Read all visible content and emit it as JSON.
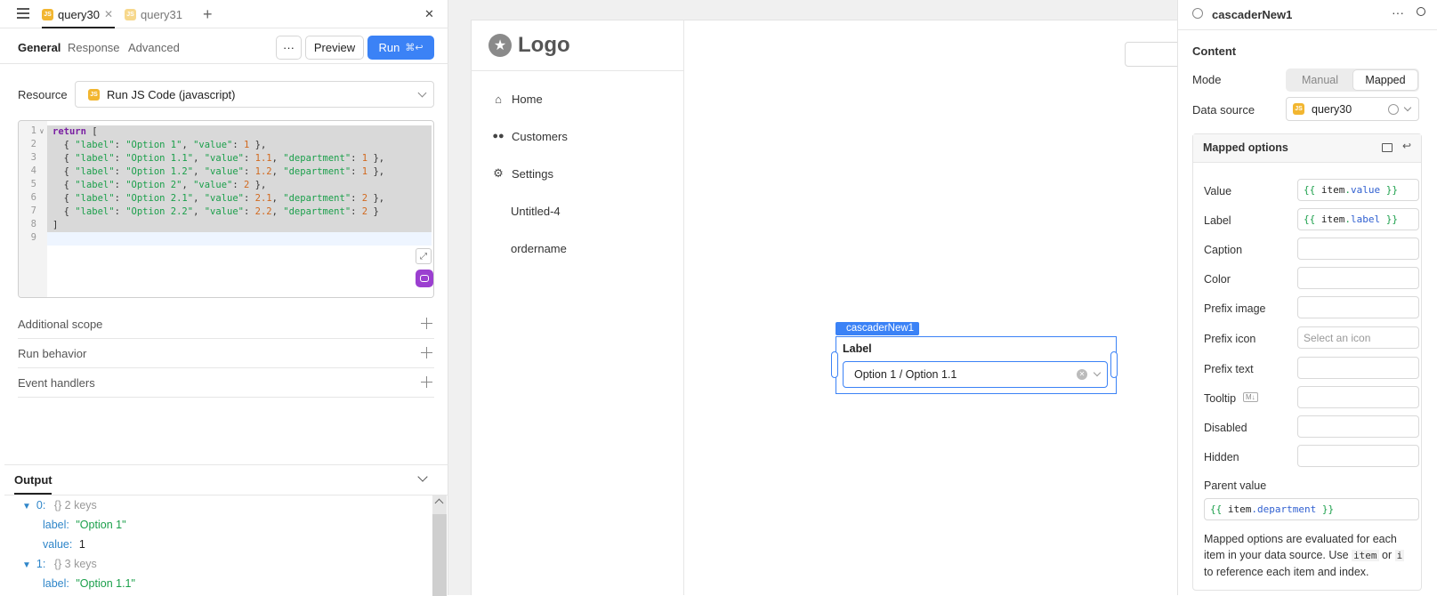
{
  "query_tabs": [
    {
      "label": "query30",
      "active": true
    },
    {
      "label": "query31",
      "active": false
    }
  ],
  "subtabs": [
    "General",
    "Response",
    "Advanced"
  ],
  "buttons": {
    "more": "···",
    "preview": "Preview",
    "run": "Run",
    "run_shortcut": "⌘↩"
  },
  "resource": {
    "label": "Resource",
    "value": "Run JS Code (javascript)"
  },
  "code_lines": [
    "return [",
    "  { \"label\": \"Option 1\", \"value\": 1 },",
    "  { \"label\": \"Option 1.1\", \"value\": 1.1, \"department\": 1 },",
    "  { \"label\": \"Option 1.2\", \"value\": 1.2, \"department\": 1 },",
    "  { \"label\": \"Option 2\", \"value\": 2 },",
    "  { \"label\": \"Option 2.1\", \"value\": 2.1, \"department\": 2 },",
    "  { \"label\": \"Option 2.2\", \"value\": 2.2, \"department\": 2 }",
    "]",
    ""
  ],
  "sections": [
    "Additional scope",
    "Run behavior",
    "Event handlers"
  ],
  "output": {
    "title": "Output",
    "rows": [
      {
        "type": "head",
        "index": "0:",
        "meta": "{}  2 keys"
      },
      {
        "type": "kv",
        "key": "label:",
        "value": "\"Option 1\"",
        "str": true
      },
      {
        "type": "kv",
        "key": "value:",
        "value": "1",
        "str": false
      },
      {
        "type": "head",
        "index": "1:",
        "meta": "{}  3 keys"
      },
      {
        "type": "kv",
        "key": "label:",
        "value": "\"Option 1.1\"",
        "str": true
      }
    ]
  },
  "app": {
    "logo": "Logo",
    "nav": [
      {
        "label": "Home",
        "icon": "home-icon"
      },
      {
        "label": "Customers",
        "icon": "users-icon"
      },
      {
        "label": "Settings",
        "icon": "gear-icon"
      },
      {
        "label": "Untitled-4",
        "icon": ""
      },
      {
        "label": "ordername",
        "icon": ""
      }
    ],
    "component_tag": "cascaderNew1",
    "field_label": "Label",
    "field_value": "Option 1 / Option 1.1"
  },
  "inspector": {
    "title": "cascaderNew1",
    "content_heading": "Content",
    "mode_label": "Mode",
    "mode_options": [
      "Manual",
      "Mapped"
    ],
    "mode_selected": "Mapped",
    "datasource_label": "Data source",
    "datasource_value": "query30",
    "mapped_heading": "Mapped options",
    "mapped_fields": [
      {
        "label": "Value",
        "value": "item.value"
      },
      {
        "label": "Label",
        "value": "item.label"
      },
      {
        "label": "Caption",
        "value": ""
      },
      {
        "label": "Color",
        "value": ""
      },
      {
        "label": "Prefix image",
        "value": ""
      },
      {
        "label": "Prefix icon",
        "placeholder": "Select an icon"
      },
      {
        "label": "Prefix text",
        "value": ""
      },
      {
        "label": "Tooltip",
        "value": "",
        "badge": "M↓"
      },
      {
        "label": "Disabled",
        "value": ""
      },
      {
        "label": "Hidden",
        "value": ""
      }
    ],
    "parent_value_label": "Parent value",
    "parent_value": "item.department",
    "help_text": [
      "Mapped options are evaluated for each",
      "item in your data source. Use",
      "or",
      "to reference each item and index."
    ],
    "help_code": [
      "item",
      "i"
    ]
  },
  "colors": {
    "accent": "#3b82f6",
    "js_badge": "#f2b630",
    "string": "#1a9f4a",
    "keyword": "#7a1fa2"
  }
}
